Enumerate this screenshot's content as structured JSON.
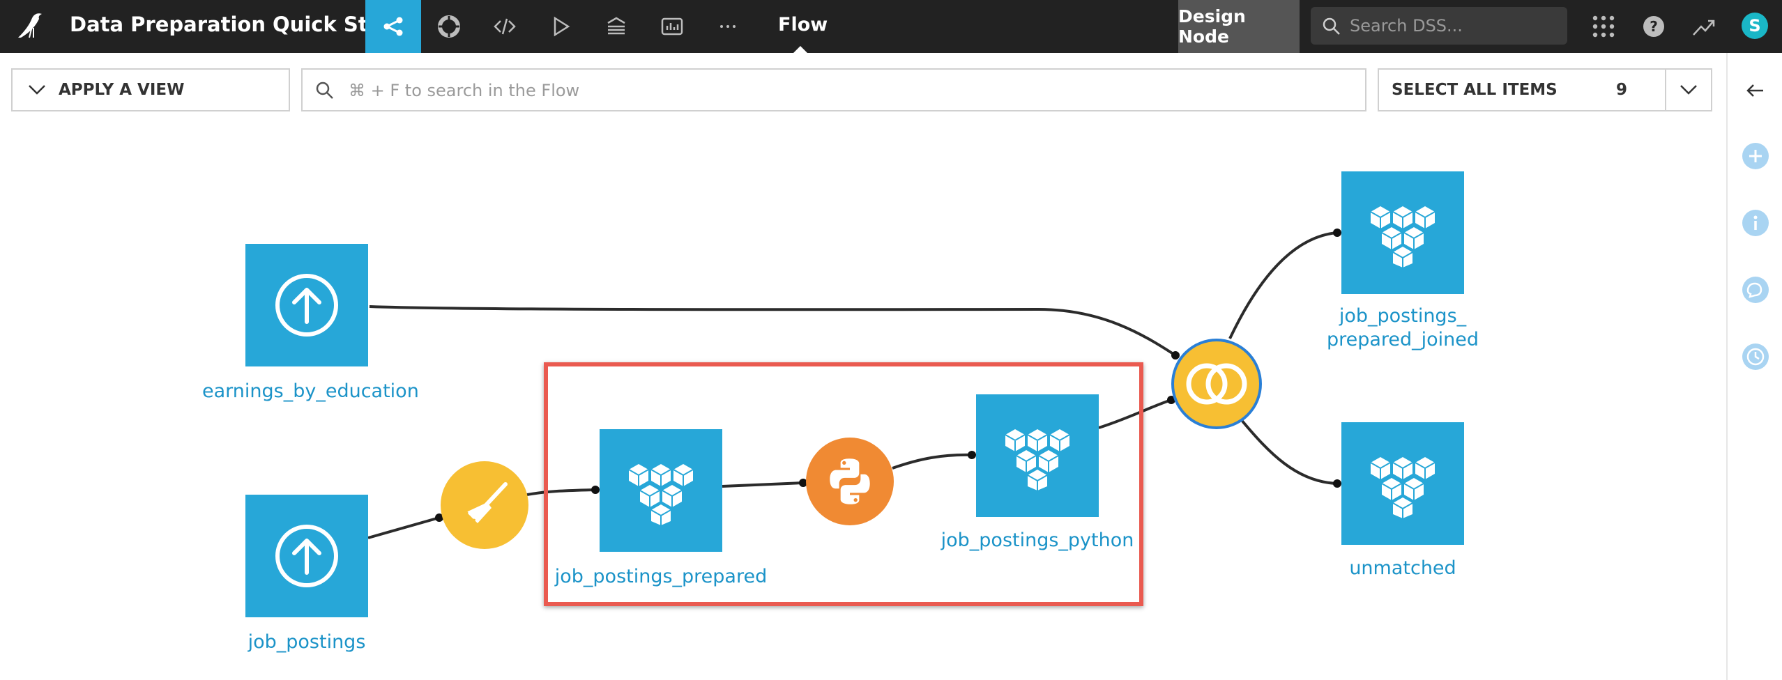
{
  "header": {
    "project_title": "Data Preparation Quick Start",
    "current_view": "Flow",
    "node_label": "Design Node",
    "search_placeholder": "Search DSS...",
    "user_initial": "S"
  },
  "toolbar": {
    "apply_view_label": "APPLY A VIEW",
    "flow_search_placeholder": "⌘ + F to search in the Flow",
    "select_all_label": "SELECT ALL ITEMS",
    "select_all_count": "9"
  },
  "flow": {
    "datasets": {
      "earnings": "earnings_by_education",
      "job_postings": "job_postings",
      "prepared": "job_postings_prepared",
      "python_out": "job_postings_python",
      "joined_line1": "job_postings_",
      "joined_line2": "prepared_joined",
      "unmatched": "unmatched"
    }
  },
  "colors": {
    "accent": "#27a7d8",
    "prepare_recipe": "#f7bf33",
    "python_recipe": "#f08a33",
    "highlight": "#ea5a50"
  }
}
